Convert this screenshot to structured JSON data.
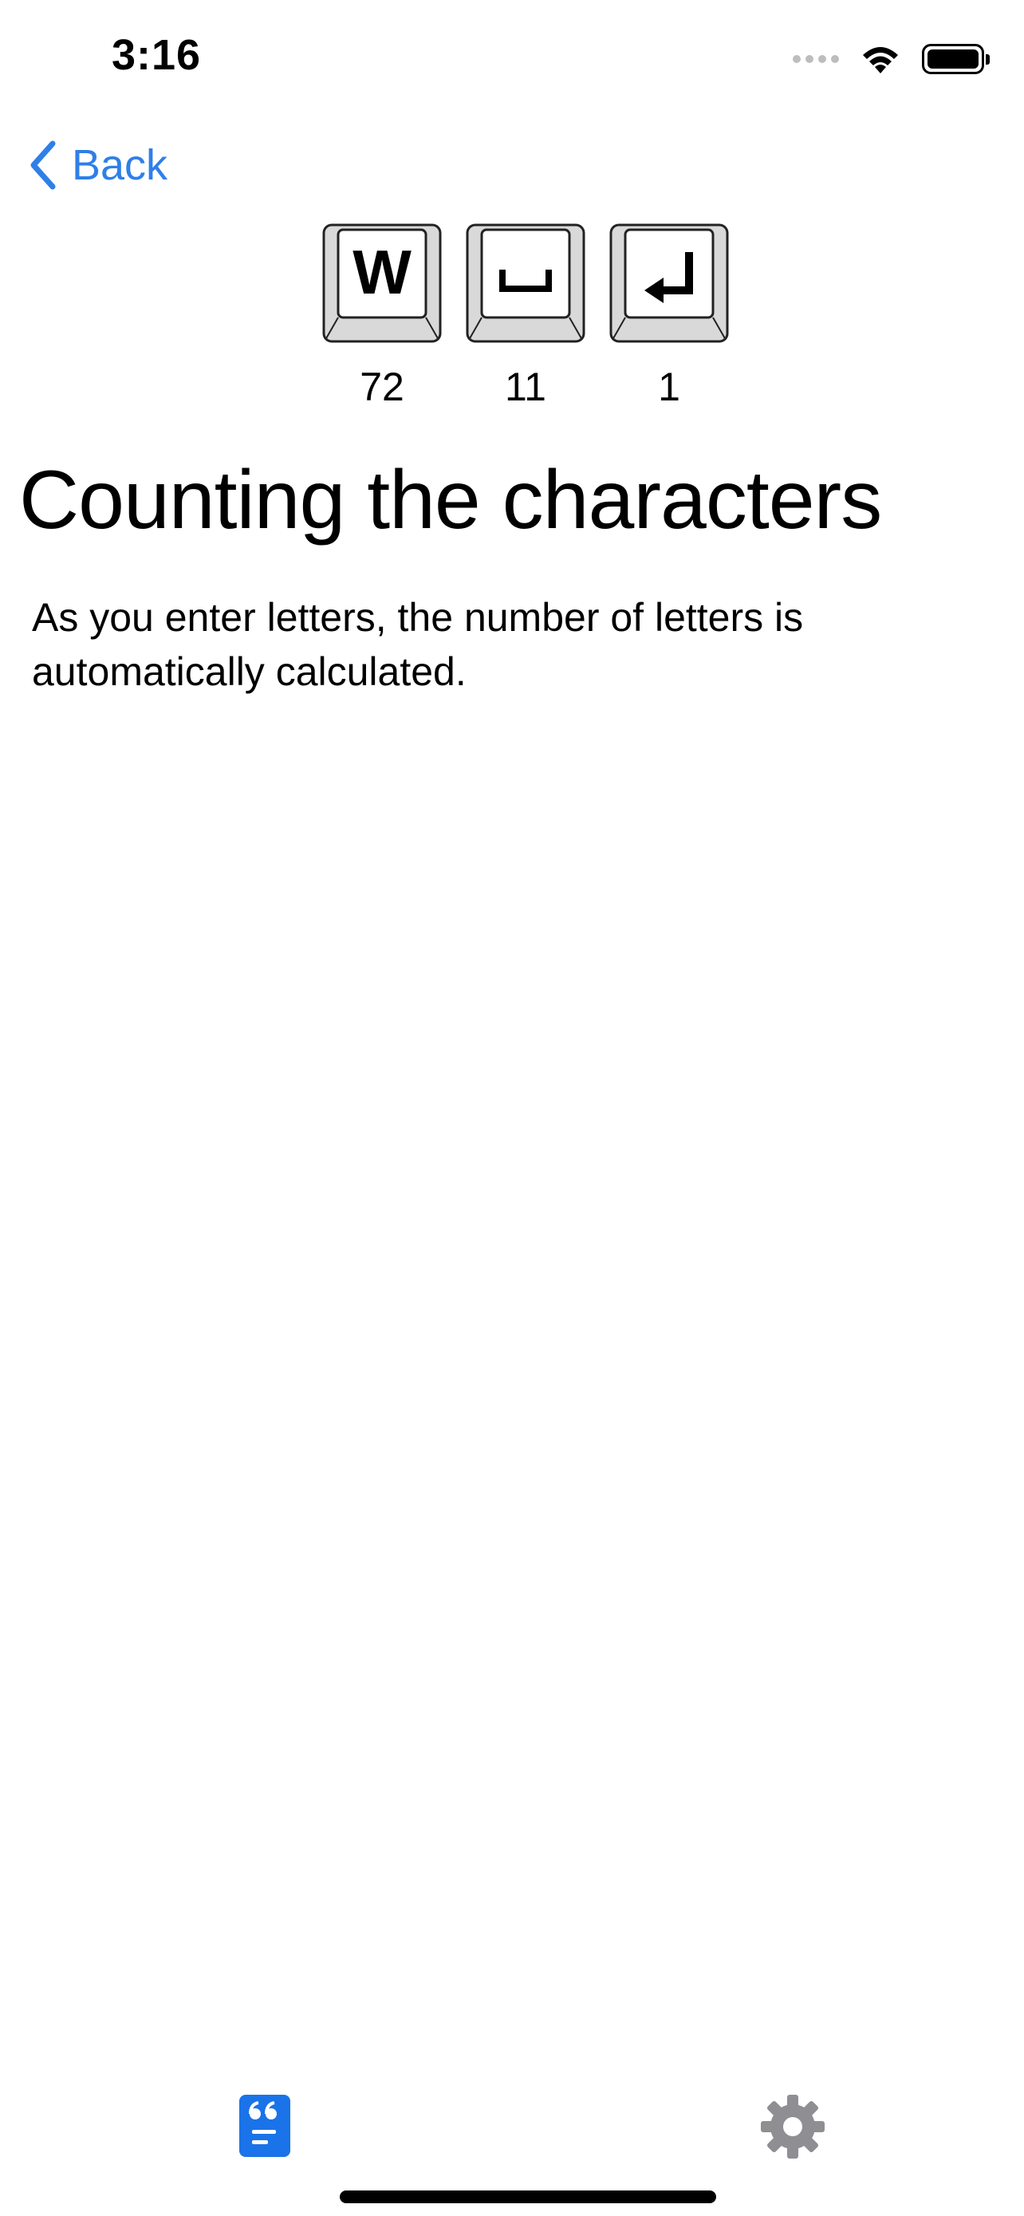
{
  "status_bar": {
    "time": "3:16",
    "icons": [
      "cellular-signal-icon",
      "wifi-icon",
      "battery-icon"
    ]
  },
  "nav": {
    "back_label": "Back",
    "accent_color": "#2f7fe8"
  },
  "counters": [
    {
      "key": "W",
      "icon": "letter-key-icon",
      "count": "72"
    },
    {
      "key": "␣",
      "icon": "space-key-icon",
      "count": "11"
    },
    {
      "key": "↵",
      "icon": "return-key-icon",
      "count": "1"
    }
  ],
  "page": {
    "title": "Counting the characters",
    "description": "As you enter letters, the number of letters is automatically calculated."
  },
  "tab_bar": {
    "tabs": [
      {
        "icon": "text-document-icon",
        "selected": true,
        "color": "#1a73e8"
      },
      {
        "icon": "gear-icon",
        "selected": false,
        "color": "#8e8e93"
      }
    ]
  }
}
